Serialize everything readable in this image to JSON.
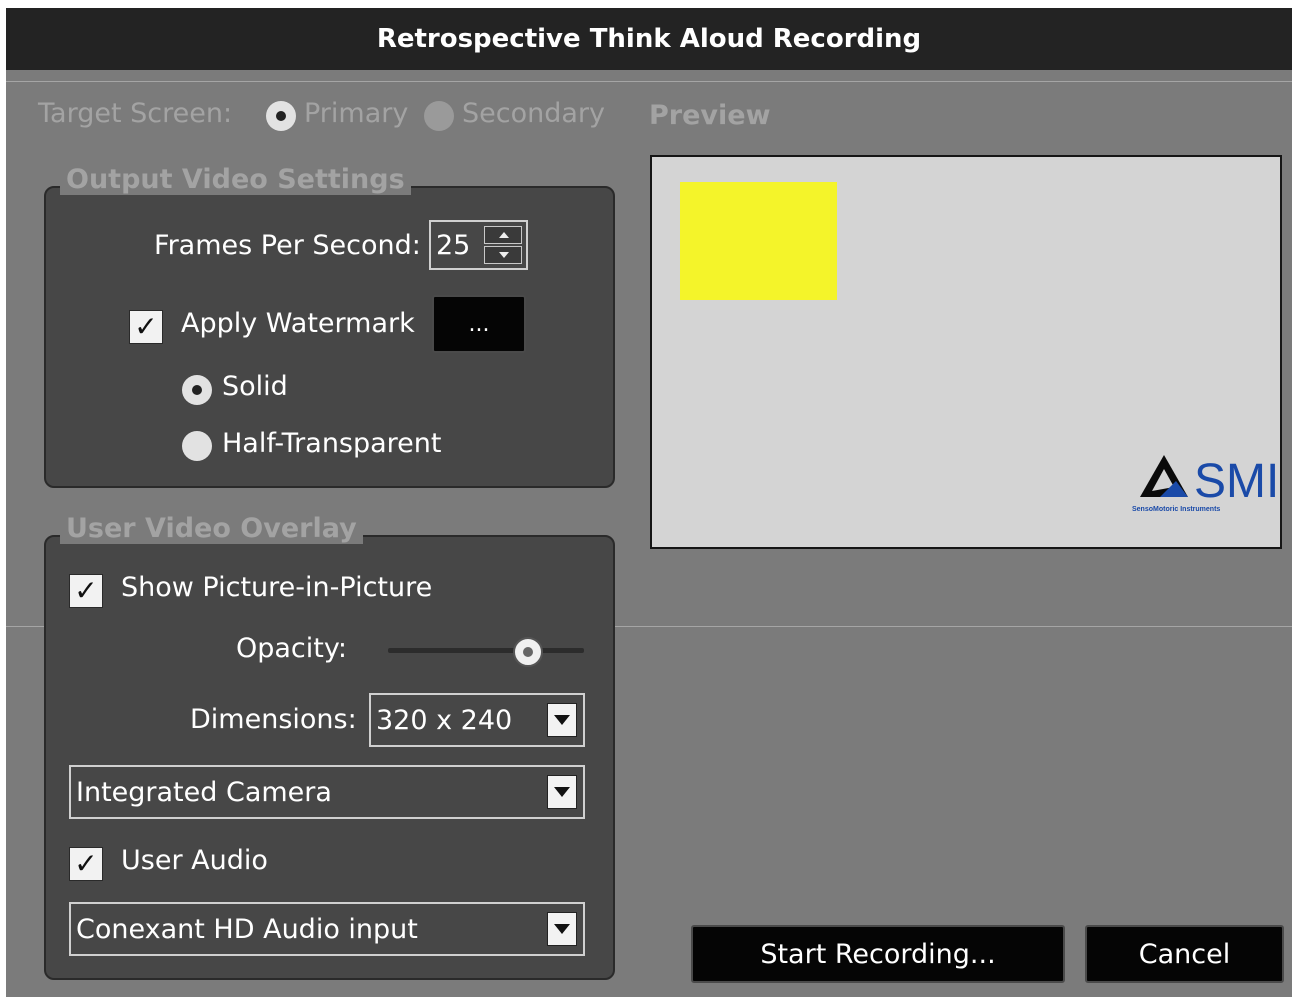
{
  "window": {
    "title": "Retrospective Think Aloud Recording"
  },
  "target_screen": {
    "label": "Target Screen:",
    "options": [
      "Primary",
      "Secondary"
    ],
    "selected": "Primary"
  },
  "output_video": {
    "legend": "Output Video Settings",
    "fps_label": "Frames Per Second:",
    "fps_value": "25",
    "watermark_label": "Apply Watermark",
    "watermark_checked": true,
    "browse_label": "...",
    "watermark_modes": [
      "Solid",
      "Half-Transparent"
    ],
    "watermark_mode_selected": "Solid"
  },
  "user_video": {
    "legend": "User Video Overlay",
    "pip_label": "Show Picture-in-Picture",
    "pip_checked": true,
    "opacity_label": "Opacity:",
    "opacity_fraction": 0.72,
    "dimensions_label": "Dimensions:",
    "dimensions_value": "320 x 240",
    "camera_value": "Integrated Camera",
    "audio_label": "User Audio",
    "audio_checked": true,
    "audio_input_value": "Conexant HD Audio input"
  },
  "preview": {
    "label": "Preview",
    "logo_text": "SMI",
    "logo_subtext": "SensoMotoric Instruments",
    "overlay_color": "#f4f42a",
    "logo_color": "#1a4aa8"
  },
  "buttons": {
    "start": "Start Recording...",
    "cancel": "Cancel"
  },
  "check_mark": "✓"
}
